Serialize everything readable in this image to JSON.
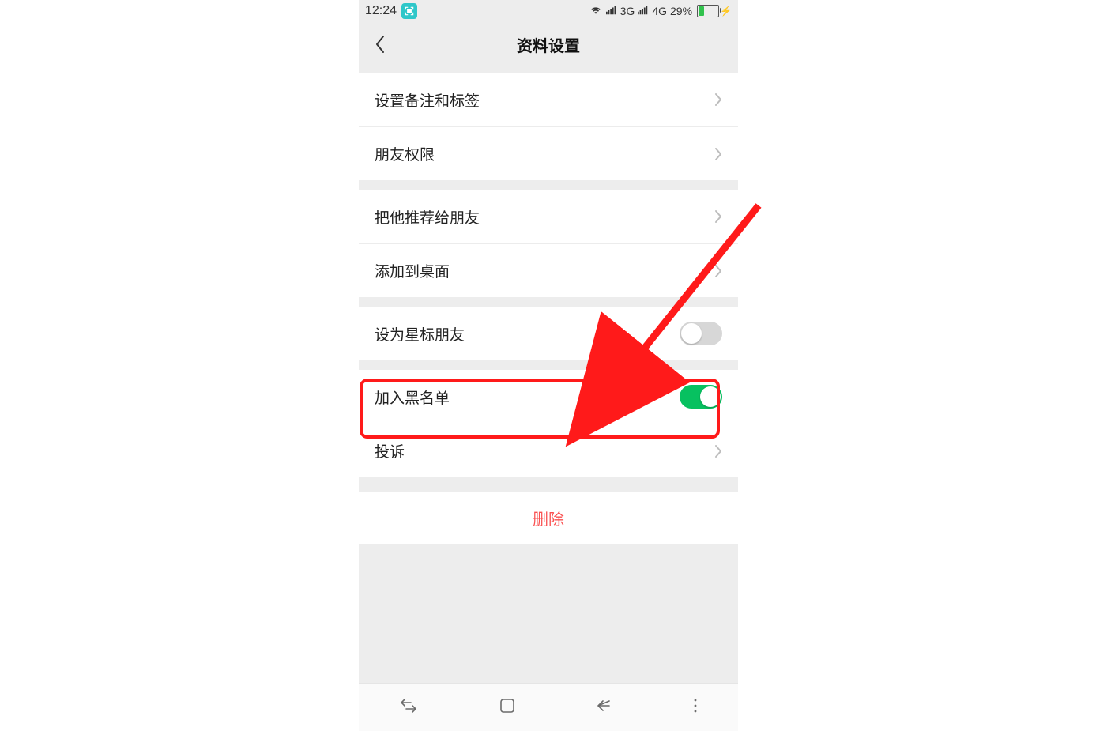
{
  "status": {
    "time": "12:24",
    "net1": "3G",
    "net2": "4G",
    "battery_pct": "29%"
  },
  "header": {
    "title": "资料设置"
  },
  "rows": {
    "remark": "设置备注和标签",
    "privacy": "朋友权限",
    "recommend": "把他推荐给朋友",
    "shortcut": "添加到桌面",
    "star": "设为星标朋友",
    "blacklist": "加入黑名单",
    "report": "投诉"
  },
  "delete_label": "删除"
}
